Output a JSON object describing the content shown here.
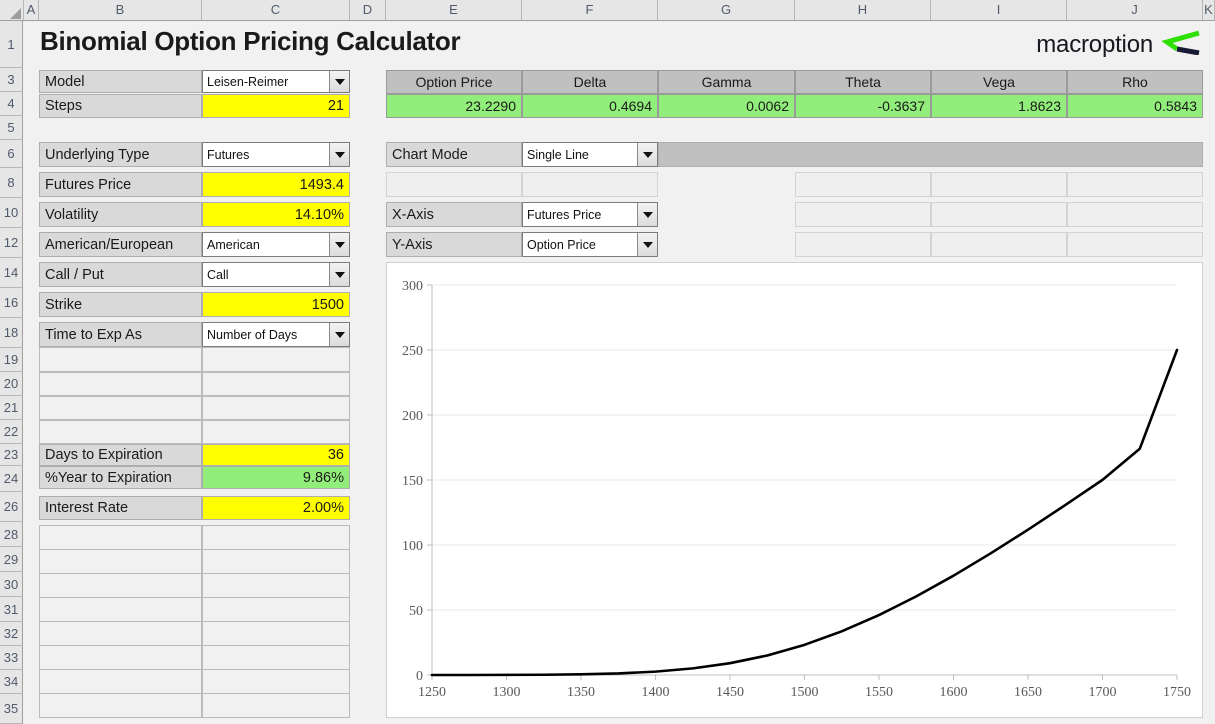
{
  "title": "Binomial Option Pricing Calculator",
  "brand": {
    "name": "macroption",
    "green": "#2ee000",
    "navy": "#161a34"
  },
  "columns": [
    "A",
    "B",
    "C",
    "D",
    "E",
    "F",
    "G",
    "H",
    "I",
    "J",
    "K"
  ],
  "rows": [
    "1",
    "3",
    "4",
    "5",
    "6",
    "8",
    "10",
    "12",
    "14",
    "16",
    "18",
    "19",
    "20",
    "21",
    "22",
    "23",
    "24",
    "26",
    "28",
    "29",
    "30",
    "31",
    "32",
    "33",
    "34",
    "35"
  ],
  "inputs": {
    "model": {
      "label": "Model",
      "value": "Leisen-Reimer"
    },
    "steps": {
      "label": "Steps",
      "value": "21"
    },
    "underlying_type": {
      "label": "Underlying Type",
      "value": "Futures"
    },
    "futures_price": {
      "label": "Futures Price",
      "value": "1493.4"
    },
    "volatility": {
      "label": "Volatility",
      "value": "14.10%"
    },
    "american_european": {
      "label": "American/European",
      "value": "American"
    },
    "call_put": {
      "label": "Call / Put",
      "value": "Call"
    },
    "strike": {
      "label": "Strike",
      "value": "1500"
    },
    "time_to_exp_as": {
      "label": "Time to Exp As",
      "value": "Number of Days"
    },
    "days_to_expiration": {
      "label": "Days to Expiration",
      "value": "36"
    },
    "pct_year_to_expiration": {
      "label": "%Year to Expiration",
      "value": "9.86%"
    },
    "interest_rate": {
      "label": "Interest Rate",
      "value": "2.00%"
    }
  },
  "greeks": {
    "headers": [
      "Option Price",
      "Delta",
      "Gamma",
      "Theta",
      "Vega",
      "Rho"
    ],
    "values": [
      "23.2290",
      "0.4694",
      "0.0062",
      "-0.3637",
      "1.8623",
      "0.5843"
    ]
  },
  "chart_controls": {
    "chart_mode": {
      "label": "Chart Mode",
      "value": "Single Line"
    },
    "x_axis": {
      "label": "X-Axis",
      "value": "Futures Price"
    },
    "y_axis": {
      "label": "Y-Axis",
      "value": "Option Price"
    }
  },
  "colors": {
    "input_yellow": "#ffff00",
    "output_green": "#92ee7a",
    "label_grey": "#d9d9d9",
    "header_grey": "#c0c0c0",
    "line": "#000000"
  },
  "chart_data": {
    "type": "line",
    "title": "",
    "xlabel": "Futures Price",
    "ylabel": "Option Price",
    "xlim": [
      1250,
      1750
    ],
    "ylim": [
      0,
      300
    ],
    "xticks": [
      1250,
      1300,
      1350,
      1400,
      1450,
      1500,
      1550,
      1600,
      1650,
      1700,
      1750
    ],
    "yticks": [
      0,
      50,
      100,
      150,
      200,
      250,
      300
    ],
    "grid": true,
    "legend": "none",
    "series": [
      {
        "name": "Option Price",
        "x": [
          1250,
          1275,
          1300,
          1325,
          1350,
          1375,
          1400,
          1425,
          1450,
          1475,
          1500,
          1525,
          1550,
          1575,
          1600,
          1625,
          1650,
          1675,
          1700,
          1725,
          1750
        ],
        "y": [
          0.0,
          0.0,
          0.1,
          0.2,
          0.5,
          1.2,
          2.6,
          5.1,
          9.1,
          15.0,
          23.2,
          33.6,
          46.1,
          60.5,
          76.4,
          93.6,
          111.8,
          130.7,
          150.1,
          174.0,
          250.0
        ]
      }
    ]
  }
}
